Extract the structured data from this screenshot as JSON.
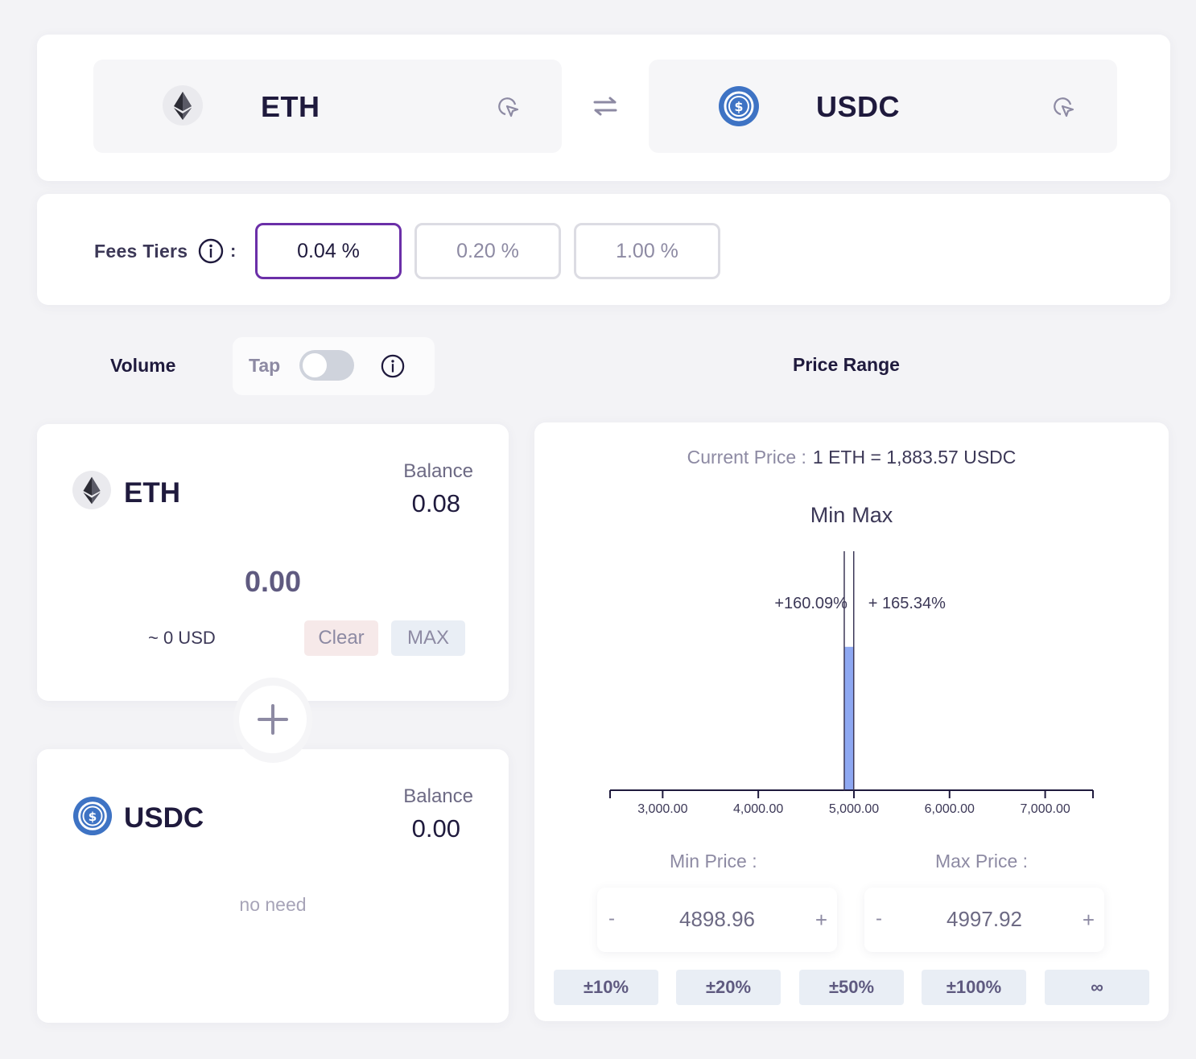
{
  "pair": {
    "token_a": {
      "symbol": "ETH",
      "icon": "eth-logo-icon"
    },
    "token_b": {
      "symbol": "USDC",
      "icon": "usdc-logo-icon"
    },
    "swap_icon": "swap-arrows-icon",
    "picker_icon": "cursor-pointer-icon"
  },
  "fees": {
    "label": "Fees Tiers",
    "colon": ":",
    "tiers": [
      {
        "label": "0.04 %",
        "selected": true
      },
      {
        "label": "0.20 %",
        "selected": false
      },
      {
        "label": "1.00 %",
        "selected": false
      }
    ]
  },
  "volume": {
    "label": "Volume",
    "tap_label": "Tap",
    "tap_enabled": false
  },
  "price_range": {
    "label": "Price Range"
  },
  "eth_card": {
    "symbol": "ETH",
    "balance_label": "Balance",
    "balance_value": "0.08",
    "amount": "0.00",
    "usd_value": "~ 0 USD",
    "clear_label": "Clear",
    "max_label": "MAX"
  },
  "usdc_card": {
    "symbol": "USDC",
    "balance_label": "Balance",
    "balance_value": "0.00",
    "note": "no need"
  },
  "plus_icon": "plus-icon",
  "range": {
    "current_price_label": "Current Price :",
    "current_price_value": "1 ETH = 1,883.57 USDC",
    "min_head": "Min",
    "max_head": "Max",
    "min_pct": "+160.09%",
    "max_pct": "+ 165.34%",
    "min_price_label": "Min Price :",
    "max_price_label": "Max Price :",
    "min_price_value": "4898.96",
    "max_price_value": "4997.92",
    "minus_symbol": "-",
    "plus_symbol": "+",
    "presets": [
      "±10%",
      "±20%",
      "±50%",
      "±100%",
      "∞"
    ]
  },
  "colors": {
    "accent": "#6b2fa8",
    "bar": "#8ea8f2",
    "usdc_blue": "#3e73c4"
  },
  "chart_data": {
    "type": "bar",
    "x_domain": [
      2450,
      7500
    ],
    "ticks": [
      3000,
      4000,
      5000,
      6000,
      7000
    ],
    "tick_labels": [
      "3,000.00",
      "4,000.00",
      "5,000.00",
      "6,000.00",
      "7,000.00"
    ],
    "min_marker": 4898.96,
    "max_marker": 4997.92,
    "bars": [
      {
        "x0": 4898.96,
        "x1": 4997.92,
        "value": 0.6
      }
    ],
    "bar_ylim": [
      0,
      1
    ]
  }
}
